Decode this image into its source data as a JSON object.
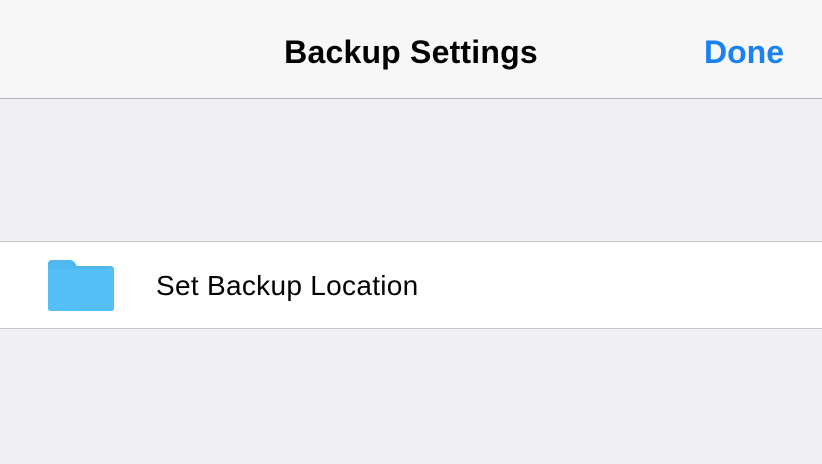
{
  "nav": {
    "title": "Backup Settings",
    "done_label": "Done"
  },
  "cell": {
    "label": "Set Backup Location",
    "icon": "folder-icon"
  },
  "colors": {
    "accent": "#1a82f0",
    "folder": "#56bff5",
    "background": "#efeff4",
    "nav_background": "#f7f7f7"
  }
}
